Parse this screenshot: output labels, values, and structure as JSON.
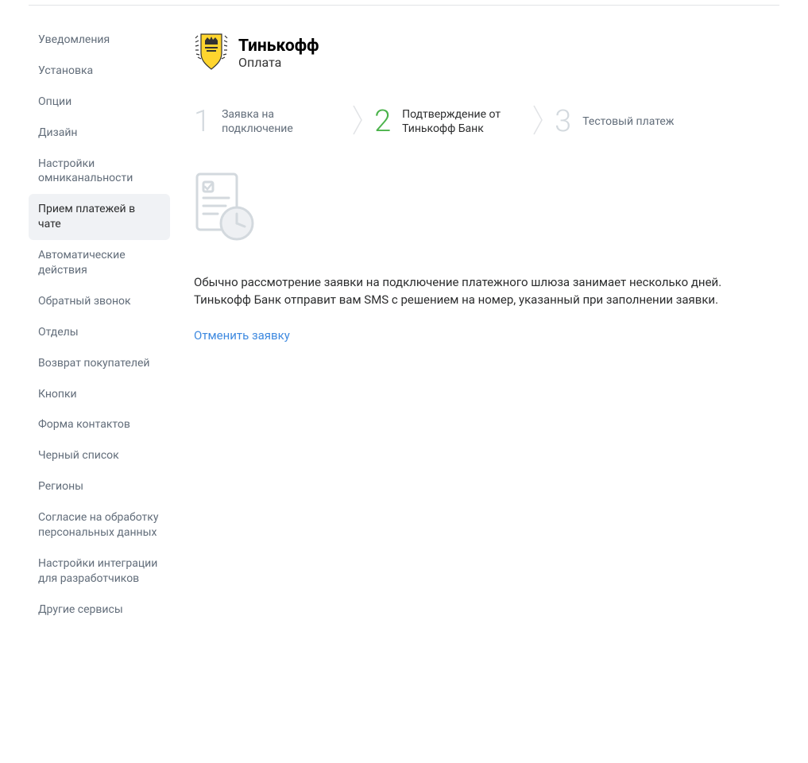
{
  "sidebar": {
    "items": [
      {
        "label": "Уведомления"
      },
      {
        "label": "Установка"
      },
      {
        "label": "Опции"
      },
      {
        "label": "Дизайн"
      },
      {
        "label": "Настройки омниканальности"
      },
      {
        "label": "Прием платежей в чате"
      },
      {
        "label": "Автоматические действия"
      },
      {
        "label": "Обратный звонок"
      },
      {
        "label": "Отделы"
      },
      {
        "label": "Возврат покупателей"
      },
      {
        "label": "Кнопки"
      },
      {
        "label": "Форма контактов"
      },
      {
        "label": "Черный список"
      },
      {
        "label": "Регионы"
      },
      {
        "label": "Согласие на обработку персональных данных"
      },
      {
        "label": "Настройки интеграции для разработчиков"
      },
      {
        "label": "Другие сервисы"
      }
    ],
    "active_index": 5
  },
  "logo": {
    "title": "Тинькофф",
    "subtitle": "Оплата"
  },
  "steps": [
    {
      "num": "1",
      "label": "Заявка на подключение"
    },
    {
      "num": "2",
      "label": "Подтверждение от Тинькофф Банк"
    },
    {
      "num": "3",
      "label": "Тестовый платеж"
    }
  ],
  "current_step_index": 1,
  "description": "Обычно рассмотрение заявки на подключение платежного шлюза занимает несколько дней. Тинькофф Банк отправит вам SMS с решением на номер, указанный при заполнении заявки.",
  "cancel_link": "Отменить заявку"
}
